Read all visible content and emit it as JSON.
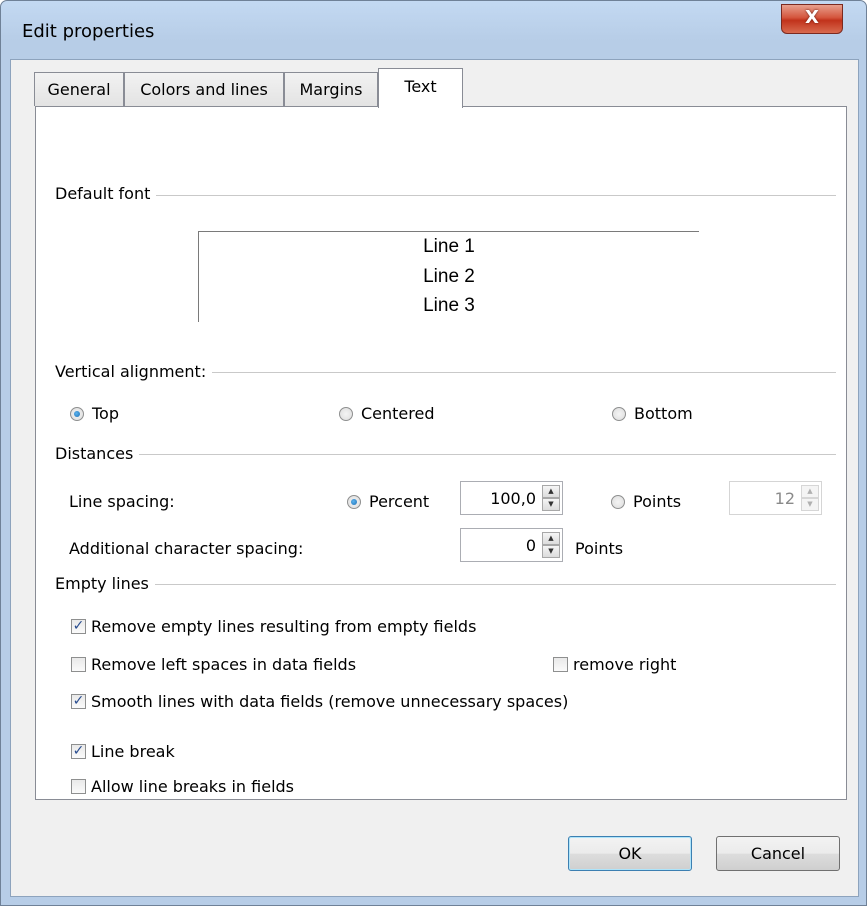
{
  "window": {
    "title": "Edit properties",
    "close_label": "X"
  },
  "tabs": [
    {
      "label": "General"
    },
    {
      "label": "Colors and lines"
    },
    {
      "label": "Margins"
    },
    {
      "label": "Text"
    }
  ],
  "default_font": {
    "group_label": "Default font",
    "preview_lines": [
      "Line 1",
      "Line 2",
      "Line 3"
    ]
  },
  "vertical_alignment": {
    "group_label": "Vertical alignment:",
    "options": [
      "Top",
      "Centered",
      "Bottom"
    ],
    "selected": "Top"
  },
  "distances": {
    "group_label": "Distances",
    "line_spacing_label": "Line spacing:",
    "percent_label": "Percent",
    "percent_value": "100,0",
    "points_label": "Points",
    "points_value": "12",
    "line_spacing_mode": "Percent",
    "char_spacing_label": "Additional character spacing:",
    "char_spacing_value": "0",
    "char_spacing_unit": "Points"
  },
  "empty_lines": {
    "group_label": "Empty lines",
    "remove_empty_lines": {
      "label": "Remove empty lines resulting from empty fields",
      "checked": true
    },
    "remove_left_spaces": {
      "label": "Remove left spaces in data fields",
      "checked": false
    },
    "remove_right": {
      "label": "remove right",
      "checked": false
    },
    "smooth_lines": {
      "label": "Smooth lines with data fields (remove unnecessary spaces)",
      "checked": true
    }
  },
  "line_break": {
    "label": "Line break",
    "checked": true
  },
  "allow_line_breaks": {
    "label": "Allow line breaks in fields",
    "checked": false
  },
  "buttons": {
    "ok": "OK",
    "cancel": "Cancel"
  }
}
